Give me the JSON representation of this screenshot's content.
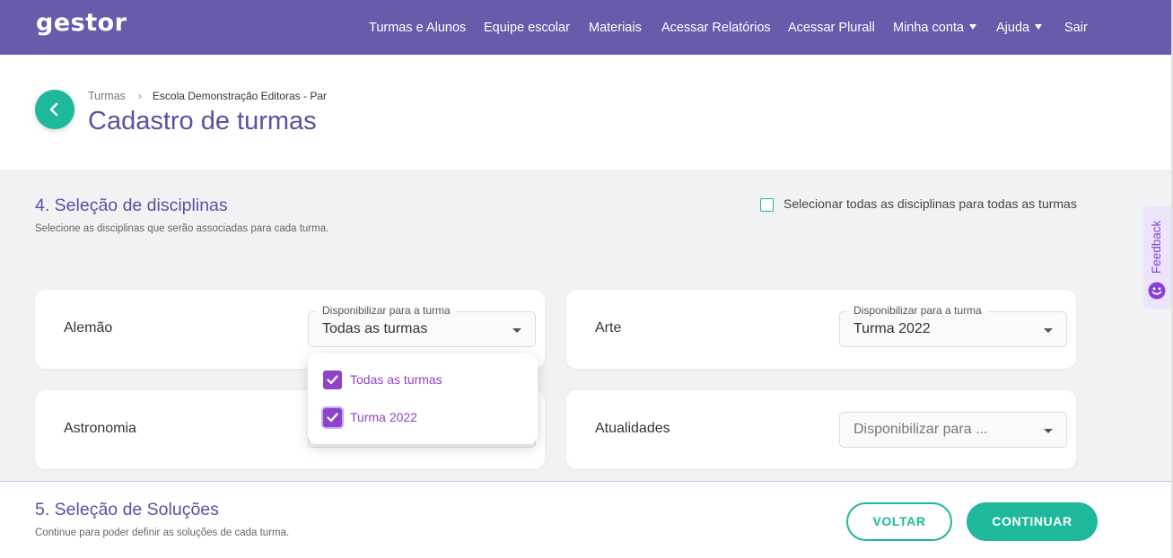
{
  "header": {
    "logo": "gestor",
    "nav": [
      {
        "label": "Turmas e Alunos",
        "dropdown": false
      },
      {
        "label": "Equipe escolar",
        "dropdown": false
      },
      {
        "label": "Materiais",
        "dropdown": false
      },
      {
        "label": "Acessar Relatórios",
        "dropdown": false
      },
      {
        "label": "Acessar Plurall",
        "dropdown": false
      },
      {
        "label": "Minha conta",
        "dropdown": true
      },
      {
        "label": "Ajuda",
        "dropdown": true
      },
      {
        "label": "Sair",
        "dropdown": false
      }
    ]
  },
  "breadcrumb": {
    "parent": "Turmas",
    "current": "Escola Demonstração Editoras - Par"
  },
  "page_title": "Cadastro de turmas",
  "section4": {
    "title": "4. Seleção de disciplinas",
    "subtitle": "Selecione as disciplinas que serão associadas para cada turma.",
    "select_all_label": "Selecionar todas as disciplinas para todas as turmas",
    "select_all_checked": false,
    "subjects": [
      {
        "name": "Alemão",
        "field_label": "Disponibilizar para a turma",
        "value": "Todas as turmas",
        "open": true
      },
      {
        "name": "Arte",
        "field_label": "Disponibilizar para a turma",
        "value": "Turma 2022",
        "open": false
      },
      {
        "name": "Astronomia",
        "field_label": "",
        "value": "",
        "open": false
      },
      {
        "name": "Atualidades",
        "field_label": "",
        "value": "Disponibilizar para ...",
        "placeholder": true,
        "open": false
      }
    ],
    "dropdown_options": [
      {
        "label": "Todas as turmas",
        "checked": true
      },
      {
        "label": "Turma 2022",
        "checked": true
      }
    ]
  },
  "feedback_tab": "Feedback",
  "section5": {
    "title": "5. Seleção de Soluções",
    "subtitle": "Continue para poder definir as soluções de cada turma."
  },
  "buttons": {
    "back": "VOLTAR",
    "continue": "CONTINUAR"
  },
  "colors": {
    "header_bg": "#6a5aab",
    "accent_green": "#1eb99a",
    "title_purple": "#5e4fa2",
    "checkbox_purple": "#8e44c8",
    "section_bg": "#f1f2f4"
  }
}
